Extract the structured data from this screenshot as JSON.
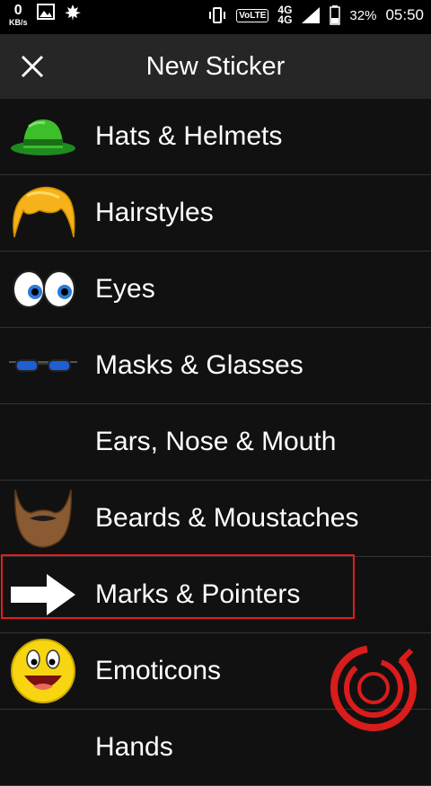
{
  "status_bar": {
    "net_speed": "0",
    "net_unit": "KB/s",
    "volte": "VoLTE",
    "network_1": "4G",
    "network_2": "4G",
    "battery": "32%",
    "time": "05:50"
  },
  "header": {
    "title": "New Sticker"
  },
  "categories": [
    {
      "label": "Hats & Helmets",
      "icon": "green-hat"
    },
    {
      "label": "Hairstyles",
      "icon": "blond-hair"
    },
    {
      "label": "Eyes",
      "icon": "cartoon-eyes"
    },
    {
      "label": "Masks & Glasses",
      "icon": "blue-glasses"
    },
    {
      "label": "Ears, Nose & Mouth",
      "icon": ""
    },
    {
      "label": "Beards & Moustaches",
      "icon": "brown-beard"
    },
    {
      "label": "Marks & Pointers",
      "icon": "white-arrow"
    },
    {
      "label": "Emoticons",
      "icon": "laughing-emoji"
    },
    {
      "label": "Hands",
      "icon": ""
    }
  ],
  "highlight_color": "#e11d1d"
}
